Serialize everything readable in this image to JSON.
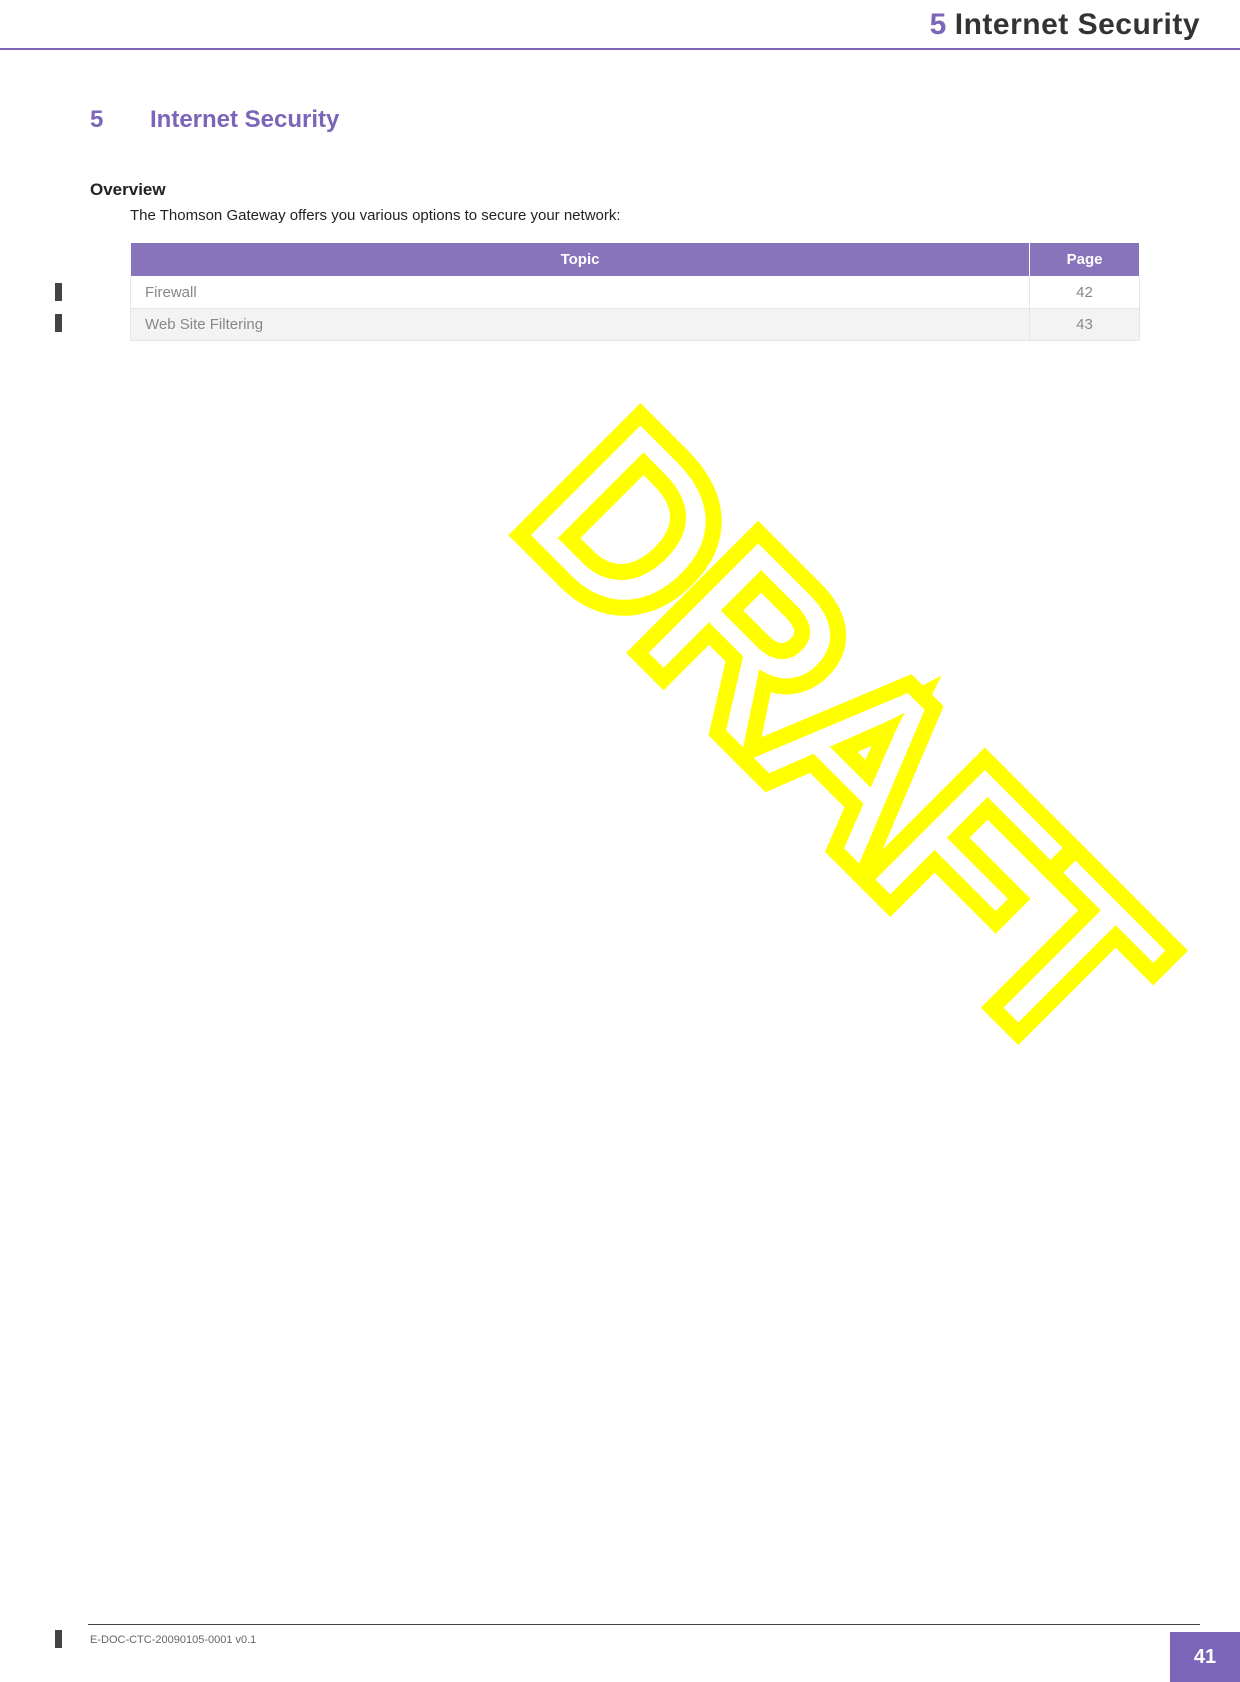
{
  "header": {
    "chapter_number": "5",
    "chapter_title": "Internet Security"
  },
  "heading": {
    "number": "5",
    "title": "Internet Security"
  },
  "section": {
    "label": "Overview",
    "intro": "The Thomson Gateway offers you various options to secure your network:"
  },
  "table": {
    "headers": {
      "topic": "Topic",
      "page": "Page"
    },
    "rows": [
      {
        "topic": "Firewall",
        "page": "42"
      },
      {
        "topic": "Web Site Filtering",
        "page": "43"
      }
    ]
  },
  "watermark": "DRAFT",
  "footer": {
    "doc_code": "E-DOC-CTC-20090105-0001 v0.1",
    "page_number": "41"
  }
}
